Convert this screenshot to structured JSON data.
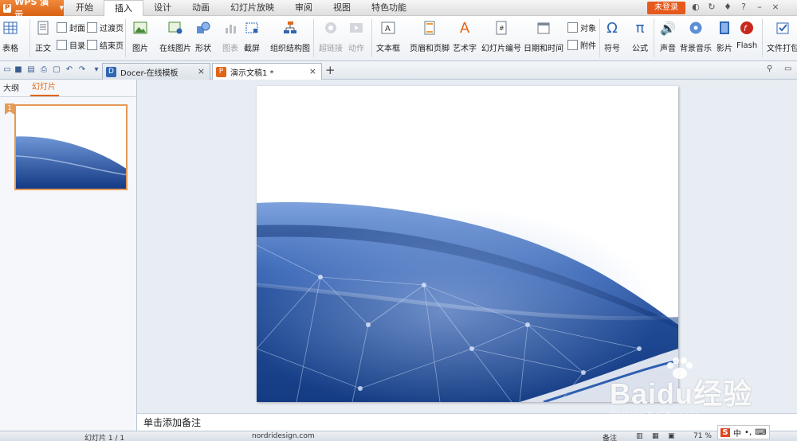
{
  "app": {
    "name": "WPS 演示",
    "logo": "P"
  },
  "menu": [
    "开始",
    "插入",
    "设计",
    "动画",
    "幻灯片放映",
    "审阅",
    "视图",
    "特色功能"
  ],
  "login": "未登录",
  "ribbon": {
    "table": "表格",
    "body_text": "正文",
    "cover": "封面",
    "toc": "目录",
    "transition_page": "过渡页",
    "end_page": "结束页",
    "picture": "图片",
    "online_picture": "在线图片",
    "shape": "形状",
    "chart": "图表",
    "screenshot": "截屏",
    "org_chart": "组织结构图",
    "hyperlink": "超链接",
    "action": "动作",
    "textbox": "文本框",
    "header_footer": "页眉和页脚",
    "wordart": "艺术字",
    "slide_number": "幻灯片编号",
    "date_time": "日期和时间",
    "object": "对象",
    "attachment": "附件",
    "symbol": "符号",
    "equation": "公式",
    "sound": "声音",
    "bg_music": "背景音乐",
    "movie": "影片",
    "flash": "Flash",
    "file_pack": "文件打包"
  },
  "tabs": [
    {
      "label": "Docer-在线模板",
      "icon": "D"
    },
    {
      "label": "演示文稿1 *",
      "icon": "P"
    }
  ],
  "panel": {
    "tabs": [
      "大纲",
      "幻灯片"
    ],
    "slide_number": "1"
  },
  "notes_placeholder": "单击添加备注",
  "status": {
    "slide": "幻灯片 1 / 1",
    "theme": "nordridesign.com",
    "notes": "备注",
    "zoom": "71 %"
  },
  "ime": "中",
  "watermark": {
    "brand": "Baidu经验",
    "url": "jingyan.baidu.com"
  },
  "colors": {
    "accent": "#e06516",
    "slide_blue": "#1f4fa3"
  }
}
